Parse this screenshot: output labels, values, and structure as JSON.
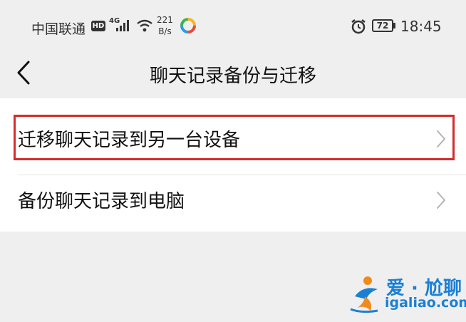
{
  "status_bar": {
    "carrier": "中国联通",
    "hd_badge": "HD",
    "network_type": "4G",
    "net_speed_value": "221",
    "net_speed_unit": "B/s",
    "battery": "72",
    "time": "18:45",
    "icons": [
      "signal-icon",
      "wifi-icon",
      "app-notification-icon",
      "alarm-icon",
      "battery-icon"
    ]
  },
  "header": {
    "title": "聊天记录备份与迁移",
    "back_icon": "chevron-left-icon"
  },
  "menu": {
    "items": [
      {
        "label": "迁移聊天记录到另一台设备",
        "highlighted": true,
        "highlight_color": "#d42c2c"
      },
      {
        "label": "备份聊天记录到电脑",
        "highlighted": false
      }
    ]
  },
  "watermark": {
    "brand": "爱 · 尬聊",
    "domain": "igaliao.com",
    "color": "#1b7fd4"
  }
}
